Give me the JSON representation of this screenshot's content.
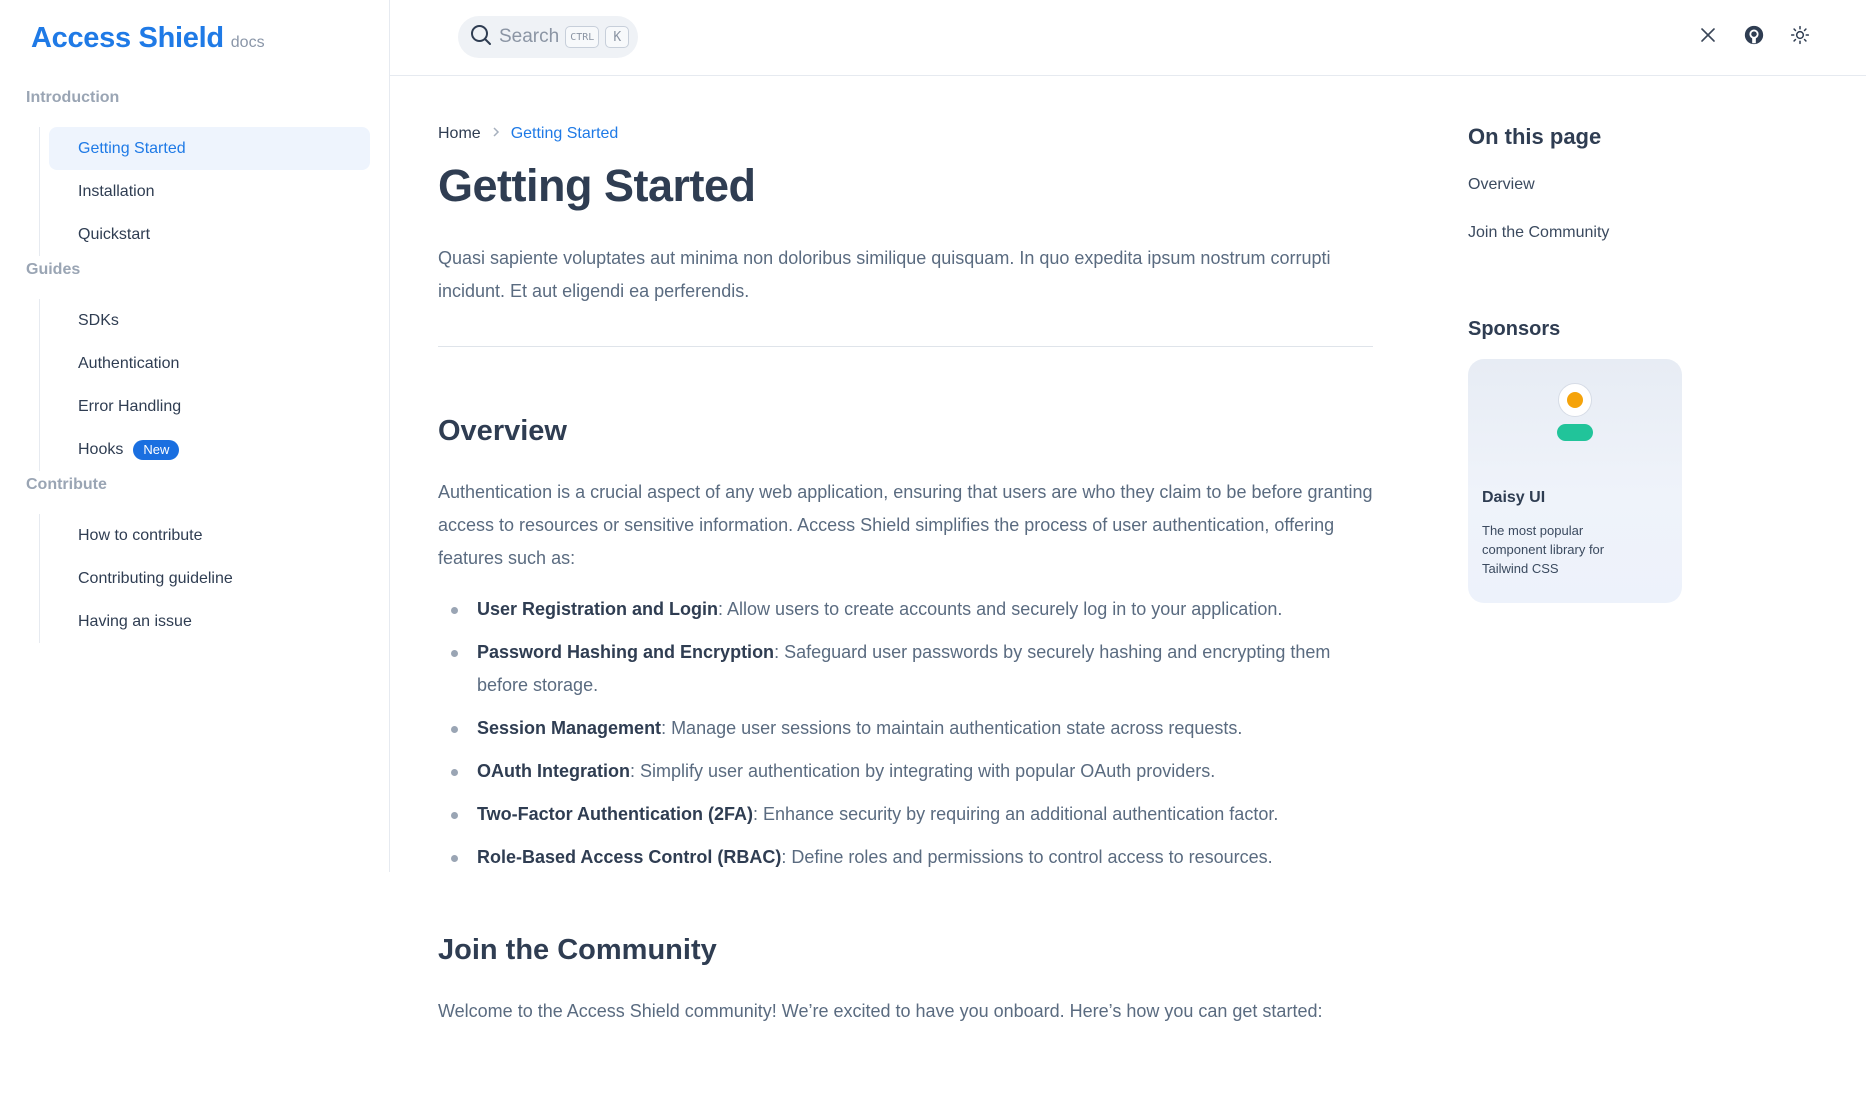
{
  "brand": {
    "name": "Access Shield",
    "suffix": "docs"
  },
  "search": {
    "placeholder": "Search",
    "key_modifier": "CTRL",
    "key": "K"
  },
  "header_icons": [
    "x-logo-icon",
    "github-icon",
    "theme-toggle-sun-icon"
  ],
  "sidebar": {
    "groups": [
      {
        "title": "Introduction",
        "items": [
          {
            "label": "Getting Started",
            "active": true
          },
          {
            "label": "Installation"
          },
          {
            "label": "Quickstart"
          }
        ]
      },
      {
        "title": "Guides",
        "items": [
          {
            "label": "SDKs"
          },
          {
            "label": "Authentication"
          },
          {
            "label": "Error Handling"
          },
          {
            "label": "Hooks",
            "badge": "New"
          }
        ]
      },
      {
        "title": "Contribute",
        "items": [
          {
            "label": "How to contribute"
          },
          {
            "label": "Contributing guideline"
          },
          {
            "label": "Having an issue"
          }
        ]
      }
    ]
  },
  "breadcrumb": {
    "home": "Home",
    "current": "Getting Started"
  },
  "main": {
    "title": "Getting Started",
    "intro": "Quasi sapiente voluptates aut minima non doloribus similique quisquam. In quo expedita ipsum nostrum corrupti incidunt. Et aut eligendi ea perferendis.",
    "overview_heading": "Overview",
    "overview_text": "Authentication is a crucial aspect of any web application, ensuring that users are who they claim to be before granting access to resources or sensitive information. Access Shield simplifies the process of user authentication, offering features such as:",
    "features": [
      {
        "term": "User Registration and Login",
        "desc": ": Allow users to create accounts and securely log in to your application."
      },
      {
        "term": "Password Hashing and Encryption",
        "desc": ": Safeguard user passwords by securely hashing and encrypting them before storage."
      },
      {
        "term": "Session Management",
        "desc": ": Manage user sessions to maintain authentication state across requests."
      },
      {
        "term": "OAuth Integration",
        "desc": ": Simplify user authentication by integrating with popular OAuth providers."
      },
      {
        "term": "Two-Factor Authentication (2FA)",
        "desc": ": Enhance security by requiring an additional authentication factor."
      },
      {
        "term": "Role-Based Access Control (RBAC)",
        "desc": ": Define roles and permissions to control access to resources."
      }
    ],
    "join_heading": "Join the Community",
    "join_text": "Welcome to the Access Shield community! We’re excited to have you onboard. Here’s how you can get started:"
  },
  "toc": {
    "title": "On this page",
    "items": [
      "Overview",
      "Join the Community"
    ]
  },
  "sponsors": {
    "title": "Sponsors",
    "card": {
      "name": "Daisy UI",
      "desc": "The most popular component library for Tailwind CSS"
    }
  },
  "colors": {
    "accent": "#1f7ae6",
    "badge": "#1a6fe0",
    "sponsor_dot": "#f5a30a",
    "sponsor_pill": "#21c49a"
  }
}
